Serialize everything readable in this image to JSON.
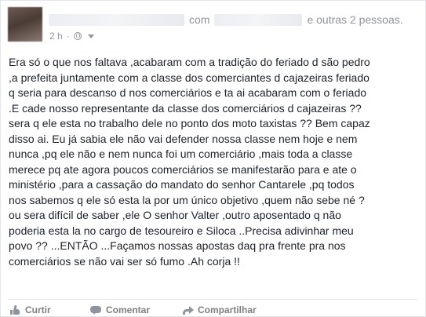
{
  "header": {
    "with_word": "com",
    "others_text": "e outras 2 pessoas."
  },
  "meta": {
    "time": "2 h",
    "separator": "·",
    "privacy_icon": "globe-icon"
  },
  "post": {
    "lines": [
      "Era só o que nos faltava ,acabaram com a tradição do feriado d são pedro",
      ",a prefeita juntamente com a classe dos comerciantes d cajazeiras feriado",
      "q seria para descanso d nos comerciários e ta ai acabaram com o feriado",
      ".E cade nosso representante da classe dos comerciários d cajazeiras ??",
      "sera q ele esta no trabalho dele no ponto dos moto taxistas ?? Bem capaz",
      "disso ai. Eu já sabia ele não vai defender nossa classe nem hoje e nem",
      "nunca ,pq ele não e nem nunca foi um comerciário ,mais toda a classe",
      "merece pq ate agora poucos comerciários se manifestarão para e ate o",
      "ministério ,para a cassação do mandato do senhor Cantarele ,pq todos",
      "nos sabemos q ele só esta la por um único objetivo ,quem não sebe né ?",
      "ou sera difícil de saber ,ele O senhor Valter ,outro aposentado q não",
      "poderia esta la no cargo de tesoureiro e Siloca ..Precisa adivinhar meu",
      "povo ?? ...ENTÃO ...Façamos nossas apostas daq pra frente pra nos",
      "comerciários se não vai ser só fumo .Ah corja !!"
    ]
  },
  "actions": {
    "like": {
      "label": "Curtir",
      "icon": "like-icon"
    },
    "comment": {
      "label": "Comentar",
      "icon": "comment-icon"
    },
    "share": {
      "label": "Compartilhar",
      "icon": "share-icon"
    }
  },
  "colors": {
    "text": "#1d2129",
    "meta": "#90949c",
    "action": "#7f7f7f"
  }
}
